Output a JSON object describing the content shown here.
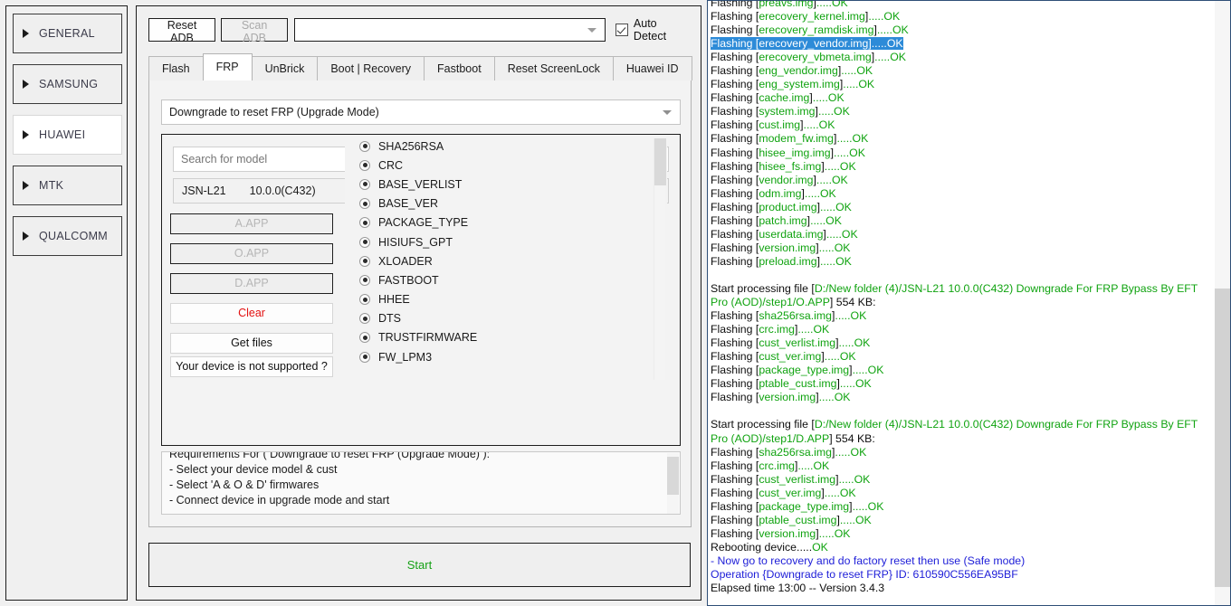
{
  "sidebar": {
    "items": [
      {
        "label": "GENERAL",
        "active": false
      },
      {
        "label": "SAMSUNG",
        "active": false
      },
      {
        "label": "HUAWEI",
        "active": true
      },
      {
        "label": "MTK",
        "active": false
      },
      {
        "label": "QUALCOMM",
        "active": false
      }
    ]
  },
  "toolbar": {
    "reset_adb": "Reset ADB",
    "scan_adb": "Scan ADB",
    "device_combo_value": "",
    "auto_detect_label": "Auto Detect",
    "auto_detect_checked": true
  },
  "tabs": [
    {
      "label": "Flash",
      "active": false
    },
    {
      "label": "FRP",
      "active": true
    },
    {
      "label": "UnBrick",
      "active": false
    },
    {
      "label": "Boot | Recovery",
      "active": false
    },
    {
      "label": "Fastboot",
      "active": false
    },
    {
      "label": "Reset ScreenLock",
      "active": false
    },
    {
      "label": "Huawei ID",
      "active": false
    }
  ],
  "frp": {
    "mode_value": "Downgrade to reset FRP (Upgrade Mode)",
    "search_placeholder": "Search for model",
    "search_value": "",
    "model_code": "JSN-L21",
    "model_version": "10.0.0(C432)",
    "buttons": [
      {
        "label": "A.APP",
        "state": "disabled"
      },
      {
        "label": "O.APP",
        "state": "disabled"
      },
      {
        "label": "D.APP",
        "state": "disabled"
      },
      {
        "label": "Clear",
        "state": "red"
      },
      {
        "label": "Get files",
        "state": "plain"
      }
    ],
    "not_supported_label": "Your device is not supported ?",
    "partitions": [
      "SHA256RSA",
      "CRC",
      "BASE_VERLIST",
      "BASE_VER",
      "PACKAGE_TYPE",
      "HISIUFS_GPT",
      "XLOADER",
      "FASTBOOT",
      "HHEE",
      "DTS",
      "TRUSTFIRMWARE",
      "FW_LPM3"
    ],
    "requirements": [
      "Requirements For ( Downgrade to reset FRP (Upgrade Mode) ):",
      " - Select your device model & cust",
      " - Select 'A & O & D' firmwares",
      " - Connect device in upgrade mode and start"
    ],
    "start_label": "Start"
  },
  "log": {
    "lines": [
      {
        "t": "flash",
        "name": "preavs.img"
      },
      {
        "t": "flash",
        "name": "erecovery_kernel.img"
      },
      {
        "t": "flash",
        "name": "erecovery_ramdisk.img"
      },
      {
        "t": "flash",
        "name": "erecovery_vendor.img",
        "selected": true
      },
      {
        "t": "flash",
        "name": "erecovery_vbmeta.img"
      },
      {
        "t": "flash",
        "name": "eng_vendor.img"
      },
      {
        "t": "flash",
        "name": "eng_system.img"
      },
      {
        "t": "flash",
        "name": "cache.img"
      },
      {
        "t": "flash",
        "name": "system.img"
      },
      {
        "t": "flash",
        "name": "cust.img"
      },
      {
        "t": "flash",
        "name": "modem_fw.img"
      },
      {
        "t": "flash",
        "name": "hisee_img.img"
      },
      {
        "t": "flash",
        "name": "hisee_fs.img"
      },
      {
        "t": "flash",
        "name": "vendor.img"
      },
      {
        "t": "flash",
        "name": "odm.img"
      },
      {
        "t": "flash",
        "name": "product.img"
      },
      {
        "t": "flash",
        "name": "patch.img"
      },
      {
        "t": "flash",
        "name": "userdata.img"
      },
      {
        "t": "flash",
        "name": "version.img"
      },
      {
        "t": "flash",
        "name": "preload.img"
      },
      {
        "t": "blank"
      },
      {
        "t": "start",
        "path": "D:/New folder (4)/JSN-L21 10.0.0(C432) Downgrade For FRP Bypass By EFT Pro (AOD)/step1/O.APP",
        "size": "554 KB:"
      },
      {
        "t": "flash",
        "name": "sha256rsa.img"
      },
      {
        "t": "flash",
        "name": "crc.img"
      },
      {
        "t": "flash",
        "name": "cust_verlist.img"
      },
      {
        "t": "flash",
        "name": "cust_ver.img"
      },
      {
        "t": "flash",
        "name": "package_type.img"
      },
      {
        "t": "flash",
        "name": "ptable_cust.img"
      },
      {
        "t": "flash",
        "name": "version.img"
      },
      {
        "t": "blank"
      },
      {
        "t": "start",
        "path": "D:/New folder (4)/JSN-L21 10.0.0(C432) Downgrade For FRP Bypass By EFT Pro (AOD)/step1/D.APP",
        "size": "554 KB:"
      },
      {
        "t": "flash",
        "name": "sha256rsa.img"
      },
      {
        "t": "flash",
        "name": "crc.img"
      },
      {
        "t": "flash",
        "name": "cust_verlist.img"
      },
      {
        "t": "flash",
        "name": "cust_ver.img"
      },
      {
        "t": "flash",
        "name": "package_type.img"
      },
      {
        "t": "flash",
        "name": "ptable_cust.img"
      },
      {
        "t": "flash",
        "name": "version.img"
      },
      {
        "t": "reboot",
        "text": "Rebooting device.....",
        "ok": "OK"
      },
      {
        "t": "info",
        "text": "- Now go to recovery and do factory reset then use (Safe mode)"
      },
      {
        "t": "info",
        "text": "Operation {Downgrade to reset FRP} ID: 610590C556EA95BF"
      },
      {
        "t": "plain",
        "text": "Elapsed time 13:00 -- Version 3.4.3"
      }
    ],
    "flash_prefix": "Flashing [",
    "flash_mid": "].....",
    "flash_ok": "OK",
    "start_prefix": "Start processing file [",
    "start_mid": "] "
  },
  "colors": {
    "accent_green": "#10a310",
    "accent_blue": "#2020d8",
    "selection_blue": "#2d8bd8",
    "clear_red": "#e31212"
  }
}
